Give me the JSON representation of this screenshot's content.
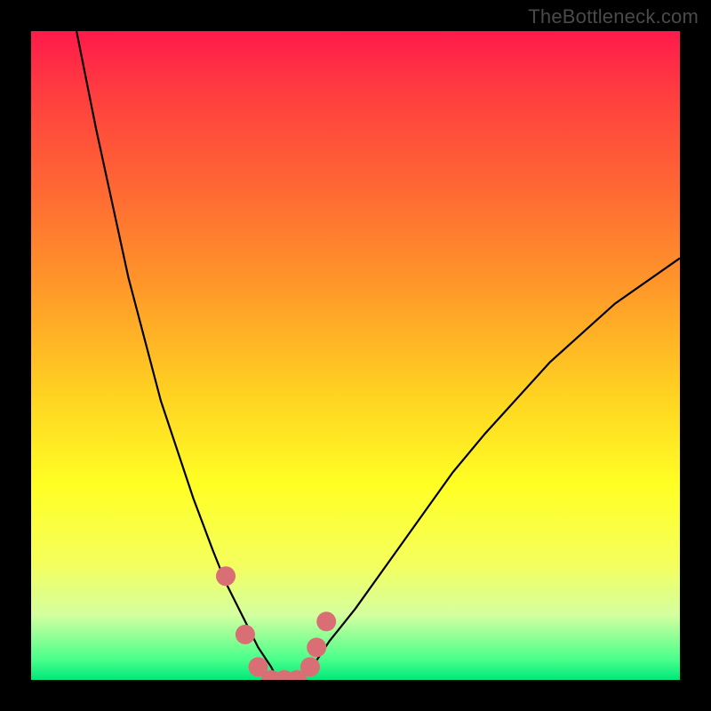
{
  "watermark": "TheBottleneck.com",
  "colors": {
    "frame": "#000000",
    "curve_stroke": "#000000",
    "marker_fill": "#d96f74",
    "gradient_top": "#ff1a4b",
    "gradient_bottom": "#00e77a"
  },
  "chart_data": {
    "type": "line",
    "title": "",
    "xlabel": "",
    "ylabel": "",
    "xlim": [
      0,
      100
    ],
    "ylim": [
      0,
      100
    ],
    "grid": false,
    "legend": false,
    "notes": "V-shaped bottleneck curve over rainbow vertical gradient. X is an unlabeled parameter (approx 0–100). Y is mismatch percentage (0 at bottom = no bottleneck, 100 at top = severe). Curve minimum lies near x≈38 at y≈0. Markers cluster near the valley.",
    "series": [
      {
        "name": "bottleneck-curve",
        "x": [
          7,
          10,
          15,
          20,
          25,
          28,
          30,
          33,
          35,
          37,
          38,
          40,
          42,
          44,
          46,
          50,
          55,
          60,
          65,
          70,
          80,
          90,
          100
        ],
        "y": [
          100,
          85,
          62,
          43,
          28,
          20,
          15,
          9,
          5,
          2,
          0,
          0,
          1,
          3,
          6,
          11,
          18,
          25,
          32,
          38,
          49,
          58,
          65
        ]
      }
    ],
    "markers": {
      "name": "highlight-points",
      "x": [
        30,
        33,
        35,
        37,
        39,
        41,
        43,
        44,
        45.5
      ],
      "y": [
        16,
        7,
        2,
        0,
        0,
        0,
        2,
        5,
        9
      ]
    }
  }
}
